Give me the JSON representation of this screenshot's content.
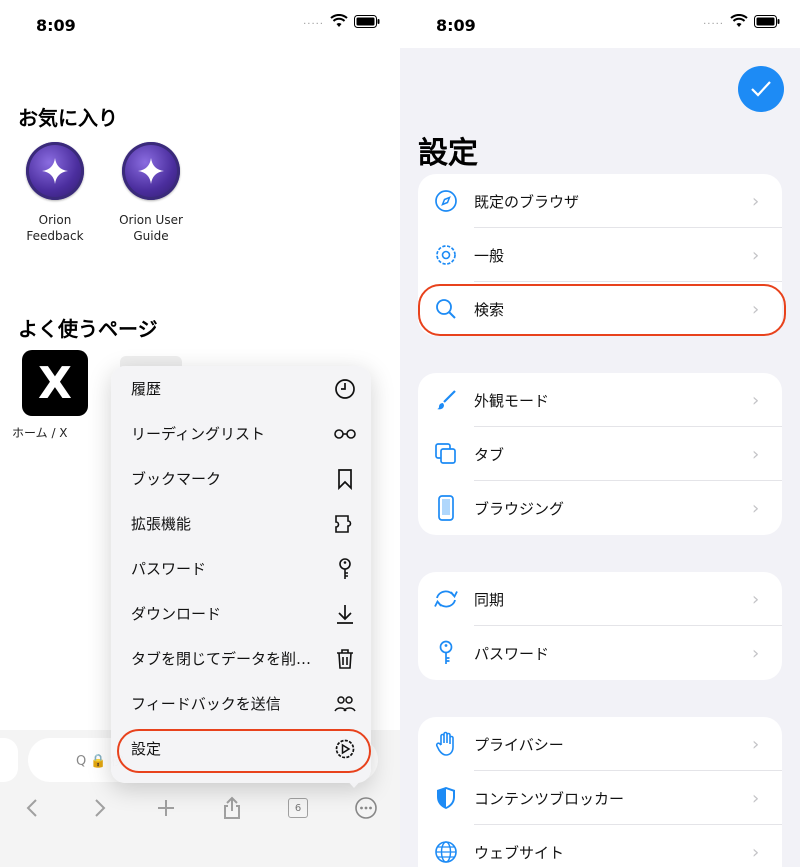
{
  "status": {
    "time_left": "8:09",
    "time_right": "8:09",
    "dots": "....."
  },
  "home": {
    "favorites_title": "お気に入り",
    "favorites": [
      {
        "label_line1": "Orion",
        "label_line2": "Feedback",
        "icon": "orion-star-icon"
      },
      {
        "label_line1": "Orion User",
        "label_line2": "Guide",
        "icon": "orion-star-icon"
      }
    ],
    "frequent_title": "よく使うページ",
    "frequent": [
      {
        "label": "ホーム / X",
        "tile_text": "X"
      }
    ],
    "search_placeholder": "Q 🔒 検"
  },
  "toolbar": {
    "tab_count": "6"
  },
  "menu": {
    "items": [
      {
        "label": "履歴",
        "icon": "clock-icon"
      },
      {
        "label": "リーディングリスト",
        "icon": "glasses-icon"
      },
      {
        "label": "ブックマーク",
        "icon": "bookmark-icon"
      },
      {
        "label": "拡張機能",
        "icon": "puzzle-icon"
      },
      {
        "label": "パスワード",
        "icon": "key-icon"
      },
      {
        "label": "ダウンロード",
        "icon": "download-icon"
      },
      {
        "label": "タブを閉じてデータを削…",
        "icon": "trash-icon"
      },
      {
        "label": "フィードバックを送信",
        "icon": "people-icon"
      },
      {
        "label": "設定",
        "icon": "gear-play-icon"
      }
    ],
    "highlighted": "設定"
  },
  "settings": {
    "title": "設定",
    "groups": [
      [
        {
          "label": "既定のブラウザ",
          "icon": "compass-icon"
        },
        {
          "label": "一般",
          "icon": "gear-icon"
        },
        {
          "label": "検索",
          "icon": "search-icon"
        }
      ],
      [
        {
          "label": "外観モード",
          "icon": "paintbrush-icon"
        },
        {
          "label": "タブ",
          "icon": "tabs-icon"
        },
        {
          "label": "ブラウジング",
          "icon": "phone-icon"
        }
      ],
      [
        {
          "label": "同期",
          "icon": "sync-icon"
        },
        {
          "label": "パスワード",
          "icon": "key-icon"
        }
      ],
      [
        {
          "label": "プライバシー",
          "icon": "hand-icon"
        },
        {
          "label": "コンテンツブロッカー",
          "icon": "shield-icon"
        },
        {
          "label": "ウェブサイト",
          "icon": "globe-icon"
        }
      ]
    ],
    "highlighted": "検索"
  },
  "colors": {
    "accent": "#1d8bf5",
    "highlight": "#e8421c"
  }
}
